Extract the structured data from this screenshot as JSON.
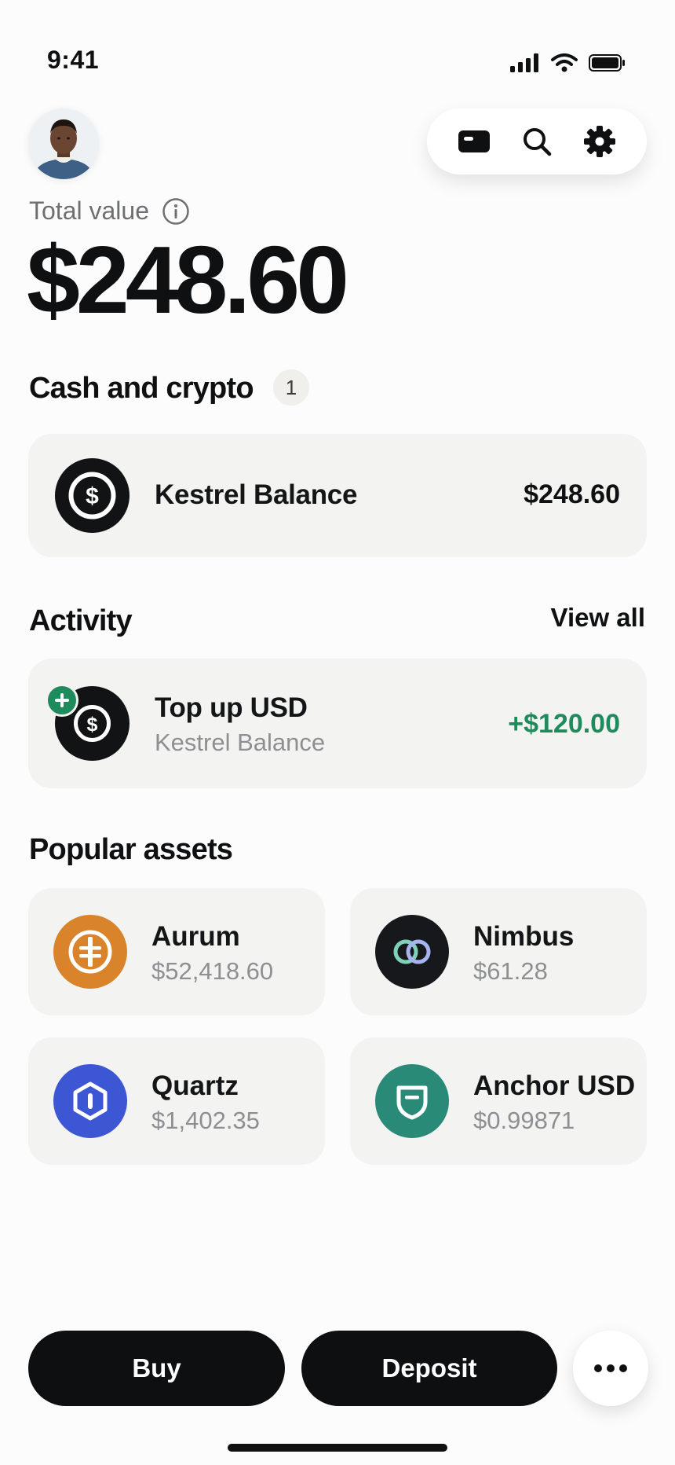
{
  "status_bar": {
    "time": "9:41"
  },
  "header": {
    "toolbar": {
      "icons": [
        "card-icon",
        "search-icon",
        "gear-icon"
      ]
    }
  },
  "portfolio": {
    "total_label": "Total value",
    "total_value": "$248.60"
  },
  "cash_and_crypto": {
    "title": "Cash and crypto",
    "count": "1",
    "items": [
      {
        "name": "Kestrel Balance",
        "amount": "$248.60",
        "icon": "dollar-coin-icon"
      }
    ]
  },
  "activity": {
    "title": "Activity",
    "view_all": "View all",
    "items": [
      {
        "title": "Top up USD",
        "subtitle": "Kestrel Balance",
        "amount": "+$120.00",
        "icon": "dollar-coin-icon",
        "badge_icon": "plus-icon"
      }
    ]
  },
  "popular_assets": {
    "title": "Popular assets",
    "items": [
      {
        "name": "Aurum",
        "price": "$52,418.60",
        "color": "#d9832a",
        "icon": "aurum-icon"
      },
      {
        "name": "Nimbus",
        "price": "$61.28",
        "color": "#16181b",
        "icon": "nimbus-icon"
      },
      {
        "name": "Quartz",
        "price": "$1,402.35",
        "color": "#3d56d4",
        "icon": "quartz-icon"
      },
      {
        "name": "Anchor USD",
        "price": "$0.99871",
        "color": "#2a8a78",
        "icon": "anchor-usd-icon"
      }
    ]
  },
  "actions": {
    "buy": "Buy",
    "deposit": "Deposit"
  },
  "colors": {
    "positive": "#1f8a5b",
    "primary": "#0e0f10",
    "card_bg": "#f3f3f1"
  }
}
